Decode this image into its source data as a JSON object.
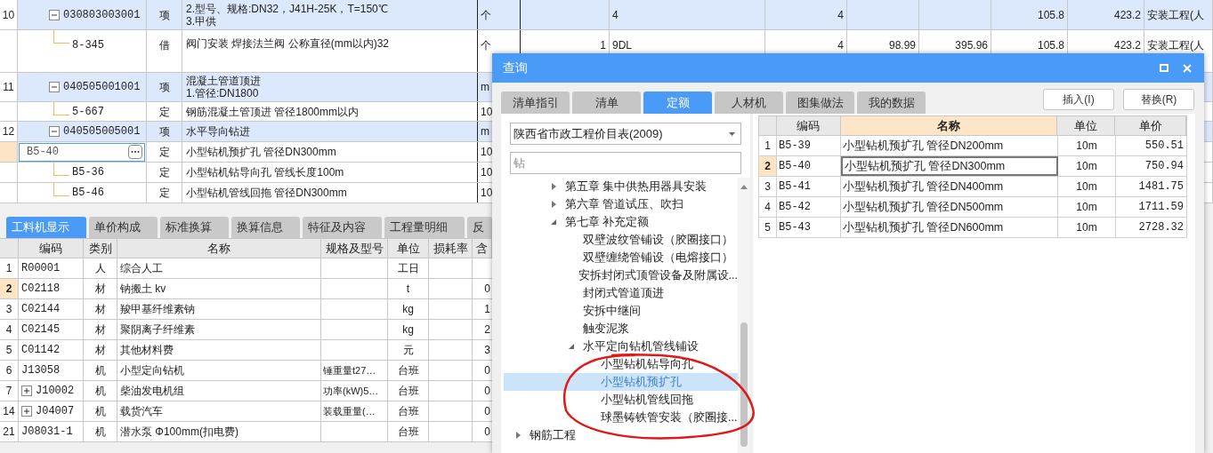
{
  "top_table": {
    "rows": [
      {
        "kind": "item",
        "number": "10",
        "code": "030803003001",
        "type": "项",
        "name_lines": [
          "2.型号、规格:DN32，J41H-25K，T=150℃",
          "3.甲供"
        ],
        "unit": "个",
        "cells": {
          "column_7": "4",
          "column_8": "4",
          "column_11": "105.8",
          "column_12": "423.2",
          "column_13": "安装工程(人"
        },
        "selected": false
      },
      {
        "kind": "quota",
        "code": "8-345",
        "type": "借",
        "name_lines": [
          "阀门安装 焊接法兰阀 公称直径(mm以内)32"
        ],
        "unit": "个",
        "cells": {
          "column_6": "1",
          "column_7": "9DL",
          "column_8": "4",
          "column_9": "98.99",
          "column_10": "395.96",
          "column_11": "105.8",
          "column_12": "423.2",
          "column_13": "安装工程(人"
        },
        "selected": false
      },
      {
        "kind": "item",
        "number": "11",
        "code": "040505001001",
        "type": "项",
        "name_lines": [
          "混凝土管道顶进",
          "1.管径:DN1800"
        ],
        "unit": "m",
        "cells": {},
        "selected": false
      },
      {
        "kind": "quota",
        "code": "5-667",
        "type": "定",
        "name_lines": [
          "钢筋混凝土管顶进 管径1800mm以内"
        ],
        "unit": "10",
        "cells": {},
        "selected": false
      },
      {
        "kind": "item",
        "number": "12",
        "code": "040505005001",
        "type": "项",
        "name_lines": [
          "水平导向钻进"
        ],
        "unit": "m",
        "cells": {},
        "selected": false
      },
      {
        "kind": "quota",
        "code": "B5-40",
        "type": "定",
        "name_lines": [
          "小型钻机预扩孔 管径DN300mm"
        ],
        "unit": "10",
        "cells": {},
        "selected": true
      },
      {
        "kind": "quota",
        "code": "B5-36",
        "type": "定",
        "name_lines": [
          "小型钻机钻导向孔 管线长度100m"
        ],
        "unit": "10",
        "cells": {},
        "selected": false
      },
      {
        "kind": "quota",
        "code": "B5-46",
        "type": "定",
        "name_lines": [
          "小型钻机管线回拖 管径DN300mm"
        ],
        "unit": "10",
        "cells": {},
        "selected": false
      }
    ]
  },
  "bottom_panel": {
    "tabs": [
      {
        "label": "工料机显示",
        "selected": true
      },
      {
        "label": "单价构成",
        "selected": false
      },
      {
        "label": "标准换算",
        "selected": false
      },
      {
        "label": "换算信息",
        "selected": false
      },
      {
        "label": "特征及内容",
        "selected": false
      },
      {
        "label": "工程量明细",
        "selected": false
      },
      {
        "label": "反",
        "selected": false
      }
    ],
    "columns": [
      "编码",
      "类别",
      "名称",
      "规格及型号",
      "单位",
      "损耗率",
      "含"
    ],
    "rows": [
      {
        "number": "1",
        "code": "R00001",
        "expandable": false,
        "type": "人",
        "name": "综合人工",
        "unit": "工日",
        "selected": false
      },
      {
        "number": "2",
        "code": "C02118",
        "expandable": false,
        "type": "材",
        "name": "钠搬土 kv",
        "unit": "t",
        "column_9": "0",
        "selected": true
      },
      {
        "number": "3",
        "code": "C02144",
        "expandable": false,
        "type": "材",
        "name": "羧甲基纤维素钠",
        "unit": "kg",
        "column_9": "1",
        "selected": false
      },
      {
        "number": "4",
        "code": "C02145",
        "expandable": false,
        "type": "材",
        "name": "聚阴离子纤维素",
        "unit": "kg",
        "column_9": "2",
        "selected": false
      },
      {
        "number": "5",
        "code": "C01142",
        "expandable": false,
        "type": "材",
        "name": "其他材料费",
        "unit": "元",
        "column_9": "3",
        "selected": false
      },
      {
        "number": "6",
        "code": "J13058",
        "expandable": false,
        "type": "机",
        "name": "小型定向钻机",
        "spec": "锤重量t27…",
        "unit": "台班",
        "column_9": "0",
        "selected": false
      },
      {
        "number": "7",
        "code": "J10002",
        "expandable": true,
        "type": "机",
        "name": "柴油发电机组",
        "spec": "功率(kW)5…",
        "unit": "台班",
        "column_9": "0",
        "selected": false
      },
      {
        "number": "14",
        "code": "J04007",
        "expandable": true,
        "type": "机",
        "name": "载货汽车",
        "spec": "装载重量(…",
        "unit": "台班",
        "column_9": "0",
        "selected": false
      },
      {
        "number": "21",
        "code": "J08031-1",
        "expandable": false,
        "type": "机",
        "name": "潜水泵 Φ100mm(扣电费)",
        "unit": "台班",
        "column_9": "0",
        "selected": false
      }
    ]
  },
  "dialog": {
    "title": "查询",
    "tabs": [
      {
        "label": "清单指引",
        "selected": false
      },
      {
        "label": "清单",
        "selected": false
      },
      {
        "label": "定额",
        "selected": true
      },
      {
        "label": "人材机",
        "selected": false
      },
      {
        "label": "图集做法",
        "selected": false
      },
      {
        "label": "我的数据",
        "selected": false
      }
    ],
    "buttons": [
      "插入(I)",
      "替换(R)"
    ],
    "library": "陕西省市政工程价目表(2009)",
    "search": {
      "value": "钻"
    },
    "tree": {
      "continued": [
        {
          "label": "第五章 集中供热用器具安装",
          "expanded": false,
          "selected": false
        },
        {
          "label": "第六章 管道试压、吹扫",
          "expanded": false,
          "selected": false
        },
        {
          "label": "第七章 补充定额",
          "expanded": true,
          "selected": false,
          "children": [
            {
              "label": "双壁波纹管铺设（胶圈接口）",
              "selected": false
            },
            {
              "label": "双壁缠绕管铺设（电熔接口）",
              "selected": false
            },
            {
              "label": "安拆封闭式顶管设备及附属设...",
              "selected": false
            },
            {
              "label": "封闭式管道顶进",
              "selected": false
            },
            {
              "label": "安拆中继间",
              "selected": false
            },
            {
              "label": "触变泥浆",
              "selected": false
            },
            {
              "label": "水平定向钻机管线铺设",
              "expanded": true,
              "selected": false,
              "children": [
                {
                  "label": "小型钻机钻导向孔",
                  "selected": false
                },
                {
                  "label": "小型钻机预扩孔",
                  "selected": true
                },
                {
                  "label": "小型钻机管线回拖",
                  "selected": false
                },
                {
                  "label": "球墨铸铁管安装（胶圈接...",
                  "selected": false
                }
              ]
            }
          ]
        }
      ],
      "items": [
        {
          "label": "钢筋工程",
          "expanded": false,
          "selected": false
        }
      ]
    },
    "table": {
      "columns": [
        "编码",
        "名称",
        "单位",
        "单价"
      ],
      "rows": [
        {
          "number": "1",
          "code": "B5-39",
          "name": "小型钻机预扩孔 管径DN200mm",
          "unit": "10m",
          "price": "550.51",
          "selected": false
        },
        {
          "number": "2",
          "code": "B5-40",
          "name": "小型钻机预扩孔 管径DN300mm",
          "unit": "10m",
          "price": "750.94",
          "selected": true
        },
        {
          "number": "3",
          "code": "B5-41",
          "name": "小型钻机预扩孔 管径DN400mm",
          "unit": "10m",
          "price": "1481.75",
          "selected": false
        },
        {
          "number": "4",
          "code": "B5-42",
          "name": "小型钻机预扩孔 管径DN500mm",
          "unit": "10m",
          "price": "1711.59",
          "selected": false
        },
        {
          "number": "5",
          "code": "B5-43",
          "name": "小型钻机预扩孔 管径DN600mm",
          "unit": "10m",
          "price": "2728.32",
          "selected": false
        }
      ]
    }
  }
}
